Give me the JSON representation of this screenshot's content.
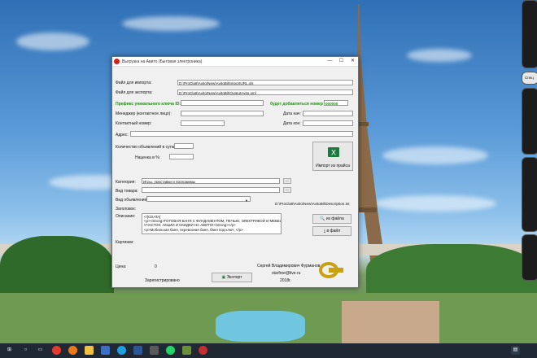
{
  "window": {
    "title": "Выгрузка на Авито (Бытовая электроника)",
    "min_glyph": "—",
    "max_glyph": "☐",
    "close_glyph": "✕"
  },
  "import": {
    "label": "Файл для импорта:",
    "value": "D:\\ProCla9\\Avito\\New\\AvitoBit\\ImportURL.xls"
  },
  "export": {
    "label": "Файл для экспорта:",
    "value": "D:\\ProCla9\\Avito\\New\\AvitoBit\\OutputAvito.xml"
  },
  "prefix": {
    "label": "Префикс уникального ключа ID:",
    "value": "",
    "number_label": "будет добавляться номер",
    "number_value": "000000"
  },
  "manager": {
    "label": "Менеджер (контактное лицо):",
    "value": ""
  },
  "date_start": {
    "label": "Дата нач:",
    "value": ""
  },
  "phone": {
    "label": "Контактный номер:",
    "value": ""
  },
  "date_end": {
    "label": "Дата кон:",
    "value": ""
  },
  "address": {
    "label": "Адрес:",
    "value": ""
  },
  "ads_per_day": {
    "label": "Количество объявлений в сутки:",
    "value": ""
  },
  "markup": {
    "label": "Наценка в %:",
    "value": ""
  },
  "price_import_button": "Импорт из прайса",
  "category": {
    "label": "Категория:",
    "value": "Игры, приставки и программы",
    "btn": "..."
  },
  "goods_type": {
    "label": "Вид товара:",
    "value": "",
    "btn": "..."
  },
  "ad_type": {
    "label": "Вид объявления:",
    "value": ""
  },
  "description_path": "D:\\ProCla9\\Avito\\New\\AvitoBit\\Description.txt",
  "heading_label": "Заголовок:",
  "description": {
    "label": "Описание:",
    "lines": [
      "<![CDATA[",
      "<p><strong>ГОТОВАЯ БАНЯ С ФУНДАМЕНТОМ, ПЕЧЬЮ, ЭЛЕКТРИКОЙ И МЕБЕЛЬЮ НА ВАШ",
      "УЧАСТОК: АКЦИИ И СКИДКИ НА АВИТО!</strong></p>",
      "<p>Мобильная баня, перевозная баня, баня под ключ, </p>"
    ],
    "from_file_button": "из файла",
    "to_file_button": "в файл"
  },
  "pictures_label": "Картинки:",
  "price": {
    "label": "Цена:",
    "value": "0"
  },
  "author": {
    "name": "Сергей Владимирович Фурманов",
    "email": "starfree@live.ru",
    "year": "2018г."
  },
  "registered_label": "Зарегистрировано",
  "export_button": "Экспорт",
  "colors": {
    "accent_green": "#2b8a1e",
    "window_bg": "#f0f0f0",
    "taskbar": "#1f2833"
  },
  "taskbar": {
    "icons": [
      "windows-start-icon",
      "search-icon",
      "task-view-icon",
      "yandex-browser-icon",
      "firefox-icon",
      "explorer-icon",
      "file-manager-icon",
      "skype-icon",
      "word-icon",
      "network-icon",
      "whatsapp-icon",
      "app-icon",
      "media-icon",
      "mail-icon"
    ],
    "clock": "",
    "tray_icons": [
      "notification-icon"
    ]
  },
  "desktop": {
    "side_widget_label": "Спец"
  }
}
